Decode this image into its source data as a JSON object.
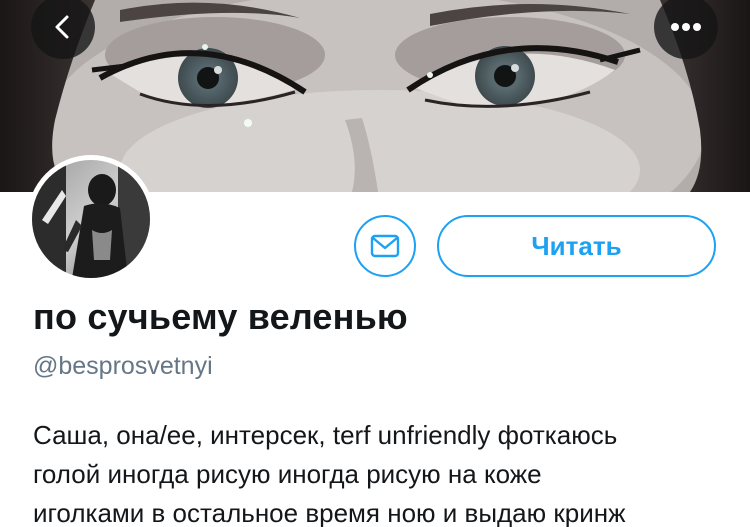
{
  "header": {
    "back_icon": "chevron-left-icon",
    "more_icon": "more-horizontal-icon"
  },
  "profile": {
    "display_name": "по сучьему веленью",
    "handle": "@besprosvetnyi",
    "bio_lines": [
      "Саша, она/ее, интерсек, terf unfriendly фоткаюсь",
      "голой иногда рисую иногда рисую на коже",
      "иголками в остальное время ною и выдаю кринж"
    ]
  },
  "actions": {
    "message_icon": "envelope-icon",
    "follow_label": "Читать"
  },
  "colors": {
    "accent": "#1da1f2",
    "text_primary": "#14171a",
    "text_secondary": "#657786"
  }
}
